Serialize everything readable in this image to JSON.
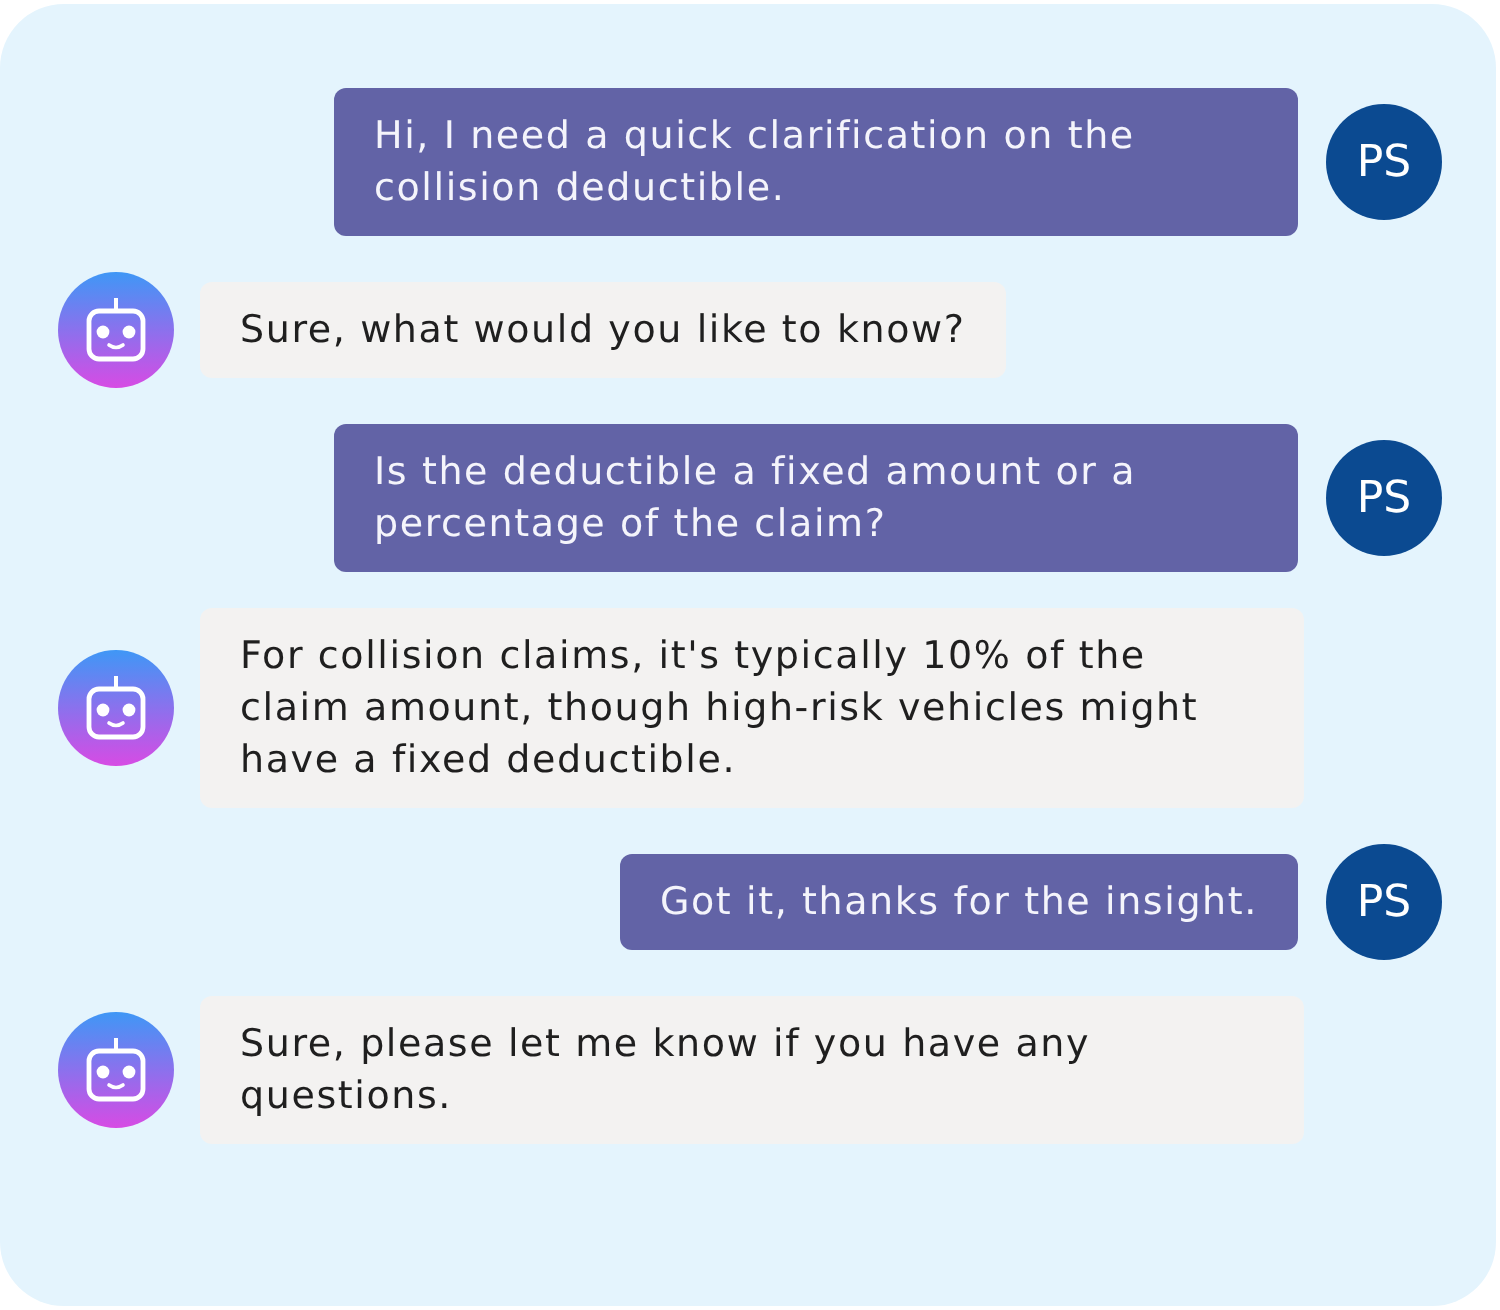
{
  "messages": [
    {
      "kind": "user",
      "initials": "PS",
      "text": "Hi, I need a quick clarification on the collision deductible."
    },
    {
      "kind": "bot",
      "text": "Sure, what would you like to know?"
    },
    {
      "kind": "user",
      "initials": "PS",
      "text": "Is the deductible a fixed amount or a percentage of the claim?"
    },
    {
      "kind": "bot",
      "text": "For collision claims, it's typically 10% of the claim amount, though high-risk vehicles might have a fixed deductible."
    },
    {
      "kind": "user",
      "initials": "PS",
      "text": "Got it, thanks for the insight."
    },
    {
      "kind": "bot",
      "text": "Sure, please let me know if you have any questions."
    }
  ]
}
